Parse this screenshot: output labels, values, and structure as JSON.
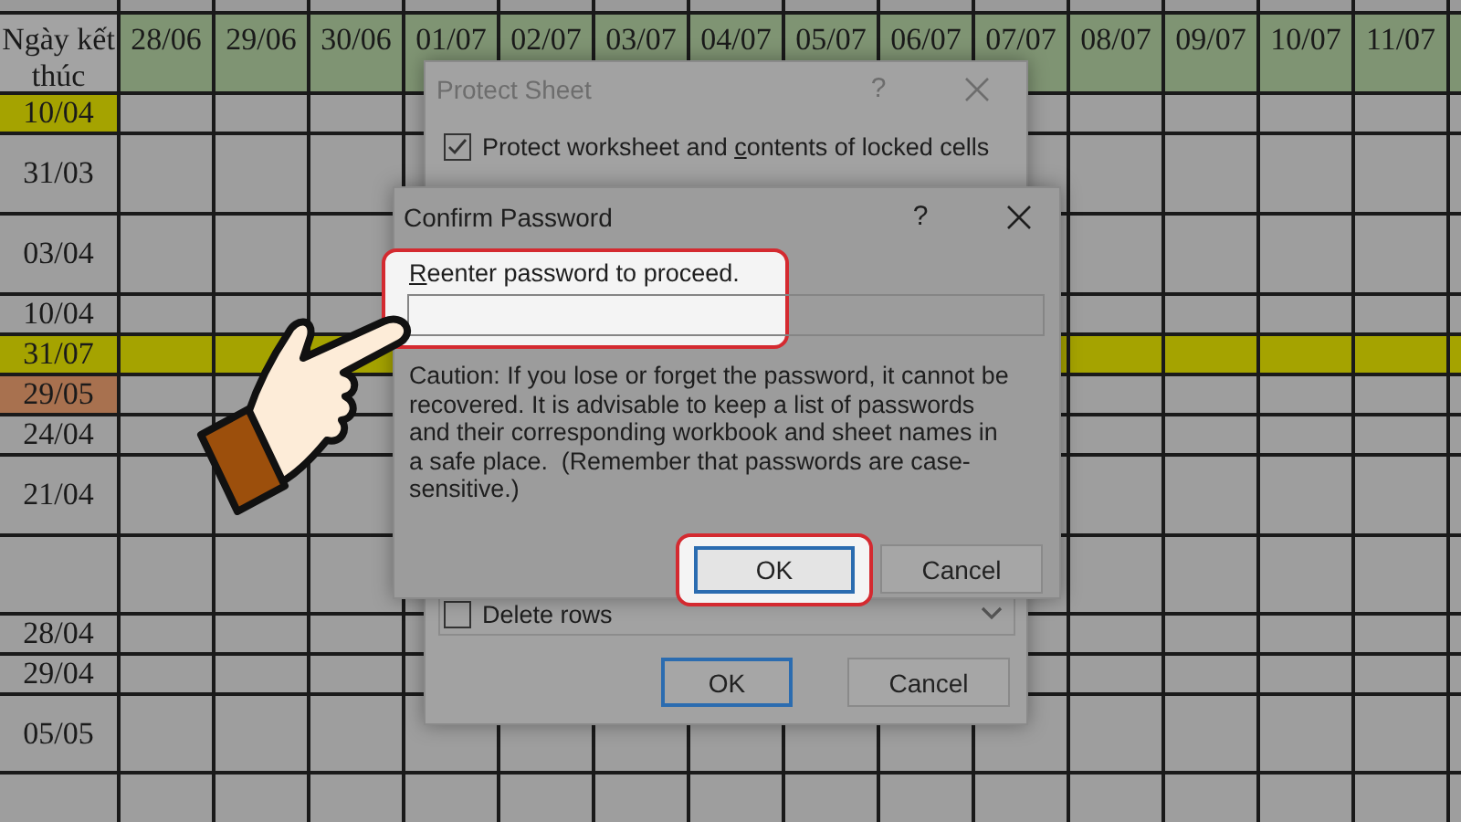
{
  "sheet": {
    "columns": [
      {
        "label": "Ngày kết thúc",
        "color": "#a3a3a3"
      },
      {
        "label": "28/06",
        "color": "#7f9473"
      },
      {
        "label": "29/06",
        "color": "#7f9473"
      },
      {
        "label": "30/06",
        "color": "#7f9473"
      },
      {
        "label": "01/07",
        "color": "#7f9473"
      },
      {
        "label": "02/07",
        "color": "#7f9473"
      },
      {
        "label": "03/07",
        "color": "#7f9473"
      },
      {
        "label": "04/07",
        "color": "#7f9473"
      },
      {
        "label": "05/07",
        "color": "#7f9473"
      },
      {
        "label": "06/07",
        "color": "#7f9473"
      },
      {
        "label": "07/07",
        "color": "#7f9473"
      },
      {
        "label": "08/07",
        "color": "#7f9473"
      },
      {
        "label": "09/07",
        "color": "#7f9473"
      },
      {
        "label": "10/07",
        "color": "#7f9473"
      },
      {
        "label": "11/07",
        "color": "#7f9473"
      }
    ],
    "rows": [
      {
        "date": "10/04",
        "kind": "first-cell",
        "color": "#a5a300"
      },
      {
        "date": "31/03",
        "kind": "plain"
      },
      {
        "date": "03/04",
        "kind": "plain"
      },
      {
        "date": "10/04",
        "kind": "plain"
      },
      {
        "date": "31/07",
        "kind": "whole-row",
        "color": "#a5a300"
      },
      {
        "date": "29/05",
        "kind": "first-cell",
        "color": "#a8714f"
      },
      {
        "date": "24/04",
        "kind": "plain"
      },
      {
        "date": "21/04",
        "kind": "plain"
      },
      {
        "kind": "plain"
      },
      {
        "date": "28/04",
        "kind": "plain"
      },
      {
        "date": "29/04",
        "kind": "plain"
      },
      {
        "date": "05/05",
        "kind": "plain"
      },
      {
        "kind": "plain"
      }
    ]
  },
  "protect_sheet": {
    "title": "Protect Sheet",
    "help": "?",
    "options": [
      {
        "parts": [
          {
            "text": "Protect worksheet and ",
            "underline": false
          },
          {
            "text": "c",
            "underline": true
          },
          {
            "text": "ontents of locked cells",
            "underline": false
          }
        ],
        "checked": true
      }
    ],
    "permissions": [
      {
        "label": "Delete rows",
        "checked": false
      }
    ],
    "buttons": [
      {
        "label": "OK",
        "default": true
      },
      {
        "label": "Cancel",
        "default": false
      }
    ]
  },
  "confirm_password": {
    "title": "Confirm Password",
    "help": "?",
    "prompt": [
      {
        "text": "R",
        "underline": true
      },
      {
        "text": "eenter password to proceed.",
        "underline": false
      }
    ],
    "prompt_highlighted": true,
    "caution": "Caution: If you lose or forget the password, it cannot be recovered. It is advisable to keep a list of passwords and their corresponding workbook and sheet names in a safe place.  (Remember that passwords are case-sensitive.)",
    "buttons": [
      {
        "label": "OK",
        "default": true,
        "highlighted": true
      },
      {
        "label": "Cancel",
        "default": false,
        "highlighted": false
      }
    ]
  }
}
